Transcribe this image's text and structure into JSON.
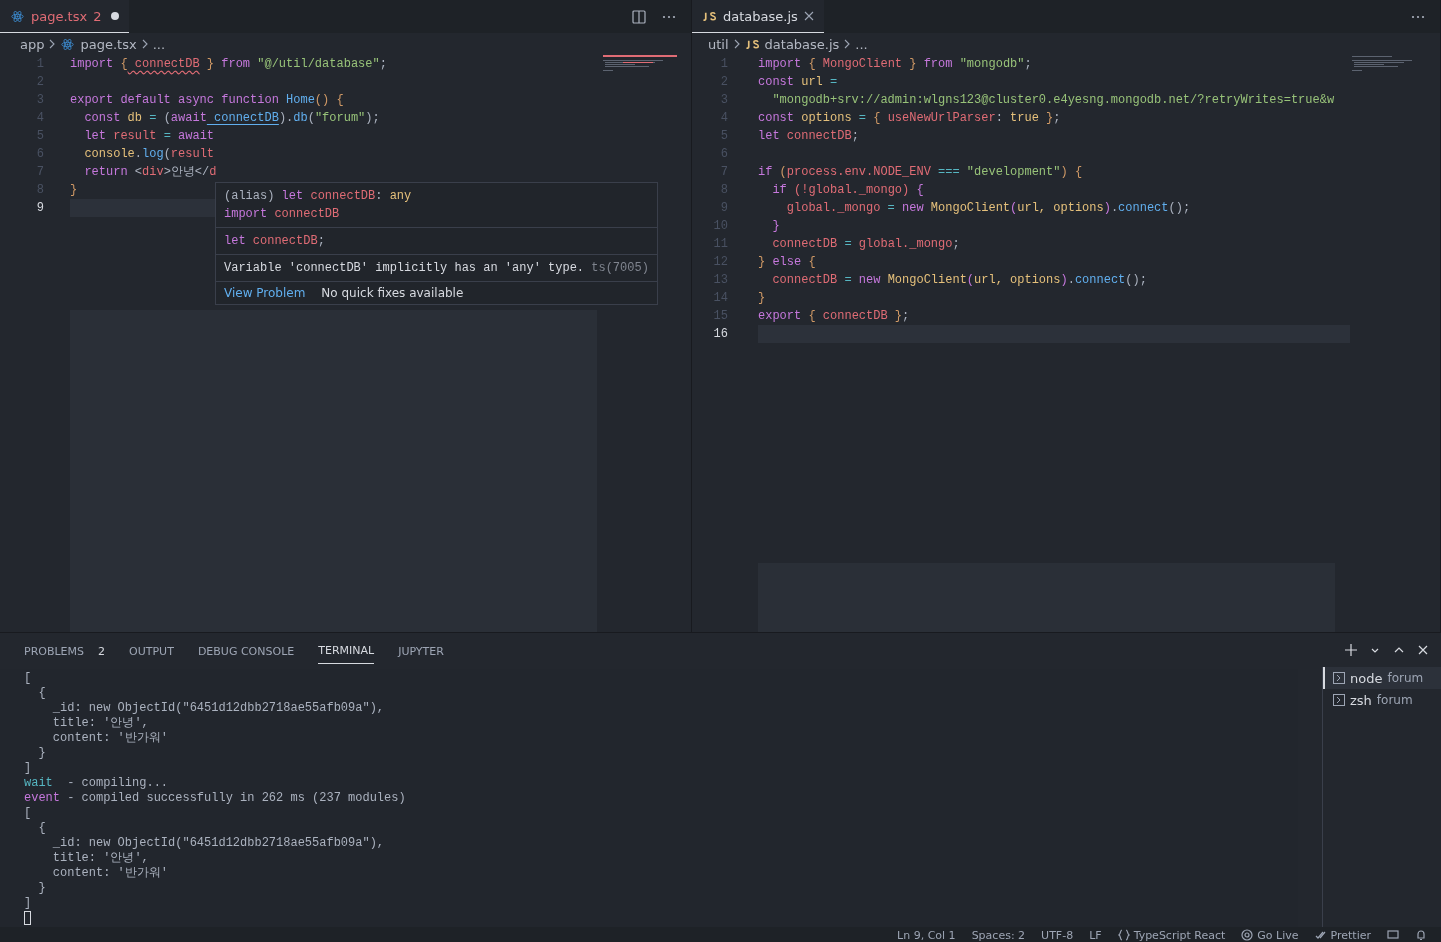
{
  "editors": [
    {
      "tab": {
        "label": "page.tsx",
        "kind": "react",
        "problems": "2",
        "modified": true,
        "selected": true
      },
      "breadcrumbs": [
        {
          "label": "app",
          "kind": "folder"
        },
        {
          "label": "page.tsx",
          "kind": "react"
        },
        {
          "label": "...",
          "kind": "more"
        }
      ],
      "lines": [
        {
          "number": "1",
          "current": false,
          "tokens": [
            {
              "text": "import",
              "kind": "keyword"
            },
            {
              "text": " {",
              "kind": "brace"
            },
            {
              "text": " connectDB",
              "kind": "var",
              "error": true
            },
            {
              "text": " }",
              "kind": "brace"
            },
            {
              "text": " from",
              "kind": "keyword"
            },
            {
              "text": " \"@/util/database\"",
              "kind": "string"
            },
            {
              "text": ";"
            }
          ]
        },
        {
          "number": "2",
          "current": false
        },
        {
          "number": "3",
          "current": false,
          "tokens": [
            {
              "text": "export default async function",
              "kind": "keyword"
            },
            {
              "text": " Home",
              "kind": "func"
            },
            {
              "text": "() {",
              "kind": "brace"
            }
          ]
        },
        {
          "number": "4",
          "current": false,
          "tokens": [
            {
              "text": "  const",
              "kind": "keyword"
            },
            {
              "text": " db",
              "kind": "const"
            },
            {
              "text": " =",
              "kind": "op"
            },
            {
              "text": " (",
              "kind": "plain"
            },
            {
              "text": "await",
              "kind": "keyword"
            },
            {
              "text": " connectDB",
              "kind": "link",
              "error": true
            },
            {
              "text": ")."
            },
            {
              "text": "db",
              "kind": "func"
            },
            {
              "text": "("
            },
            {
              "text": "\"forum\"",
              "kind": "string"
            },
            {
              "text": ");"
            }
          ]
        },
        {
          "number": "5",
          "current": false,
          "tokens": [
            {
              "text": "  let",
              "kind": "keyword"
            },
            {
              "text": " result",
              "kind": "var"
            },
            {
              "text": " =",
              "kind": "op"
            },
            {
              "text": " await",
              "kind": "keyword"
            }
          ]
        },
        {
          "number": "6",
          "current": false,
          "tokens": [
            {
              "text": "  console",
              "kind": "const"
            },
            {
              "text": "."
            },
            {
              "text": "log",
              "kind": "func"
            },
            {
              "text": "("
            },
            {
              "text": "result",
              "kind": "var"
            }
          ]
        },
        {
          "number": "7",
          "current": false,
          "tokens": [
            {
              "text": "  return",
              "kind": "keyword"
            },
            {
              "text": " <"
            },
            {
              "text": "div",
              "kind": "var"
            },
            {
              "text": ">안녕</"
            },
            {
              "text": "d",
              "kind": "var"
            }
          ]
        },
        {
          "number": "8",
          "current": false,
          "tokens": [
            {
              "text": "}",
              "kind": "brace"
            }
          ]
        },
        {
          "number": "9",
          "current": true
        }
      ],
      "hover": {
        "signature": [
          {
            "text": "(alias)"
          },
          {
            "text": " let",
            "kind": "keyword"
          },
          {
            "text": " connectDB",
            "kind": "var"
          },
          {
            "text": ": "
          },
          {
            "text": "any",
            "kind": "const"
          }
        ],
        "import_line": [
          {
            "text": "import",
            "kind": "keyword"
          },
          {
            "text": " connectDB",
            "kind": "var"
          }
        ],
        "declaration": [
          {
            "text": "let",
            "kind": "keyword"
          },
          {
            "text": " connectDB",
            "kind": "var"
          },
          {
            "text": ";"
          }
        ],
        "message": "Variable 'connectDB' implicitly has an 'any' type.",
        "code": "ts(7005)",
        "action": "View Problem",
        "note": "No quick fixes available"
      }
    },
    {
      "tab": {
        "label": "database.js",
        "kind": "js",
        "modified": false,
        "selected": true
      },
      "breadcrumbs": [
        {
          "label": "util",
          "kind": "folder"
        },
        {
          "label": "database.js",
          "kind": "js"
        },
        {
          "label": "...",
          "kind": "more"
        }
      ],
      "lines": [
        {
          "number": "1",
          "current": false,
          "tokens": [
            {
              "text": "import",
              "kind": "keyword"
            },
            {
              "text": " {",
              "kind": "brace"
            },
            {
              "text": " MongoClient",
              "kind": "var"
            },
            {
              "text": " }",
              "kind": "brace"
            },
            {
              "text": " from",
              "kind": "keyword"
            },
            {
              "text": " \"mongodb\"",
              "kind": "string"
            },
            {
              "text": ";"
            }
          ]
        },
        {
          "number": "2",
          "current": false,
          "tokens": [
            {
              "text": "const",
              "kind": "keyword"
            },
            {
              "text": " url",
              "kind": "const"
            },
            {
              "text": " =",
              "kind": "op"
            }
          ]
        },
        {
          "number": "3",
          "current": false,
          "tokens": [
            {
              "text": "  \"mongodb+srv://admin:wlgns123@cluster0.e4yesng.mongodb.net/?retryWrites=true&w",
              "kind": "string"
            }
          ]
        },
        {
          "number": "4",
          "current": false,
          "tokens": [
            {
              "text": "const",
              "kind": "keyword"
            },
            {
              "text": " options",
              "kind": "const"
            },
            {
              "text": " =",
              "kind": "op"
            },
            {
              "text": " {",
              "kind": "brace"
            },
            {
              "text": " useNewUrlParser",
              "kind": "var"
            },
            {
              "text": ": "
            },
            {
              "text": "true",
              "kind": "const"
            },
            {
              "text": " }",
              "kind": "brace"
            },
            {
              "text": ";"
            }
          ]
        },
        {
          "number": "5",
          "current": false,
          "tokens": [
            {
              "text": "let",
              "kind": "keyword"
            },
            {
              "text": " connectDB",
              "kind": "var"
            },
            {
              "text": ";"
            }
          ]
        },
        {
          "number": "6",
          "current": false
        },
        {
          "number": "7",
          "current": false,
          "tokens": [
            {
              "text": "if",
              "kind": "keyword"
            },
            {
              "text": " (",
              "kind": "brace"
            },
            {
              "text": "process.env.NODE_ENV",
              "kind": "var"
            },
            {
              "text": " ===",
              "kind": "op"
            },
            {
              "text": " \"development\"",
              "kind": "string"
            },
            {
              "text": ") {",
              "kind": "brace"
            }
          ]
        },
        {
          "number": "8",
          "current": false,
          "tokens": [
            {
              "text": "  if",
              "kind": "keyword"
            },
            {
              "text": " (!global._mongo)",
              "kind": "var"
            },
            {
              "text": " {",
              "kind": "keyword"
            }
          ]
        },
        {
          "number": "9",
          "current": false,
          "tokens": [
            {
              "text": "    global._mongo",
              "kind": "var"
            },
            {
              "text": " =",
              "kind": "op"
            },
            {
              "text": " new",
              "kind": "keyword"
            },
            {
              "text": " MongoClient",
              "kind": "const"
            },
            {
              "text": "(",
              "kind": "keyword"
            },
            {
              "text": "url, options",
              "kind": "const"
            },
            {
              "text": ")",
              "kind": "keyword"
            },
            {
              "text": "."
            },
            {
              "text": "connect",
              "kind": "func"
            },
            {
              "text": "();",
              "kind": "plain"
            }
          ]
        },
        {
          "number": "10",
          "current": false,
          "tokens": [
            {
              "text": "  }",
              "kind": "keyword"
            }
          ]
        },
        {
          "number": "11",
          "current": false,
          "tokens": [
            {
              "text": "  connectDB",
              "kind": "var"
            },
            {
              "text": " =",
              "kind": "op"
            },
            {
              "text": " global._mongo",
              "kind": "var"
            },
            {
              "text": ";"
            }
          ]
        },
        {
          "number": "12",
          "current": false,
          "tokens": [
            {
              "text": "}",
              "kind": "brace"
            },
            {
              "text": " else",
              "kind": "keyword"
            },
            {
              "text": " {",
              "kind": "brace"
            }
          ]
        },
        {
          "number": "13",
          "current": false,
          "tokens": [
            {
              "text": "  connectDB",
              "kind": "var"
            },
            {
              "text": " =",
              "kind": "op"
            },
            {
              "text": " new",
              "kind": "keyword"
            },
            {
              "text": " MongoClient",
              "kind": "const"
            },
            {
              "text": "(",
              "kind": "keyword"
            },
            {
              "text": "url, options",
              "kind": "const"
            },
            {
              "text": ")",
              "kind": "keyword"
            },
            {
              "text": "."
            },
            {
              "text": "connect",
              "kind": "func"
            },
            {
              "text": "();"
            }
          ]
        },
        {
          "number": "14",
          "current": false,
          "tokens": [
            {
              "text": "}",
              "kind": "brace"
            }
          ]
        },
        {
          "number": "15",
          "current": false,
          "tokens": [
            {
              "text": "export",
              "kind": "keyword"
            },
            {
              "text": " {",
              "kind": "brace"
            },
            {
              "text": " connectDB",
              "kind": "var"
            },
            {
              "text": " }",
              "kind": "brace"
            },
            {
              "text": ";"
            }
          ]
        },
        {
          "number": "16",
          "current": true
        }
      ]
    }
  ],
  "panel": {
    "tabs": [
      {
        "label": "PROBLEMS",
        "badge": "2",
        "selected": false
      },
      {
        "label": "OUTPUT",
        "selected": false
      },
      {
        "label": "DEBUG CONSOLE",
        "selected": false
      },
      {
        "label": "TERMINAL",
        "selected": true
      },
      {
        "label": "JUPYTER",
        "selected": false
      }
    ],
    "terminal_lines": [
      [
        {
          "text": "["
        }
      ],
      [
        {
          "text": "  {"
        }
      ],
      [
        {
          "text": "    _id: new ObjectId(\"6451d12dbb2718ae55afb09a\"),"
        }
      ],
      [
        {
          "text": "    title: '안녕',"
        }
      ],
      [
        {
          "text": "    content: '반가워'"
        }
      ],
      [
        {
          "text": "  }"
        }
      ],
      [
        {
          "text": "]"
        }
      ],
      [
        {
          "text": "wait",
          "kind": "op"
        },
        {
          "text": "  - compiling..."
        }
      ],
      [
        {
          "text": "event",
          "kind": "keyword"
        },
        {
          "text": " - compiled successfully in 262 ms (237 modules)"
        }
      ],
      [
        {
          "text": "["
        }
      ],
      [
        {
          "text": "  {"
        }
      ],
      [
        {
          "text": "    _id: new ObjectId(\"6451d12dbb2718ae55afb09a\"),"
        }
      ],
      [
        {
          "text": "    title: '안녕',"
        }
      ],
      [
        {
          "text": "    content: '반가워'"
        }
      ],
      [
        {
          "text": "  }"
        }
      ],
      [
        {
          "text": "]"
        }
      ]
    ],
    "terminals": [
      {
        "name": "node",
        "folder": "forum",
        "selected": true
      },
      {
        "name": "zsh",
        "folder": "forum",
        "selected": false
      }
    ]
  },
  "status_bar": [
    {
      "label": "Ln 9, Col 1",
      "kind": "text"
    },
    {
      "label": "Spaces: 2",
      "kind": "text"
    },
    {
      "label": "UTF-8",
      "kind": "text"
    },
    {
      "label": "LF",
      "kind": "text"
    },
    {
      "label": "TypeScript React",
      "kind": "language"
    },
    {
      "label": "Go Live",
      "kind": "live"
    },
    {
      "label": "Prettier",
      "kind": "prettier"
    },
    {
      "kind": "feedback"
    },
    {
      "kind": "bell"
    }
  ]
}
